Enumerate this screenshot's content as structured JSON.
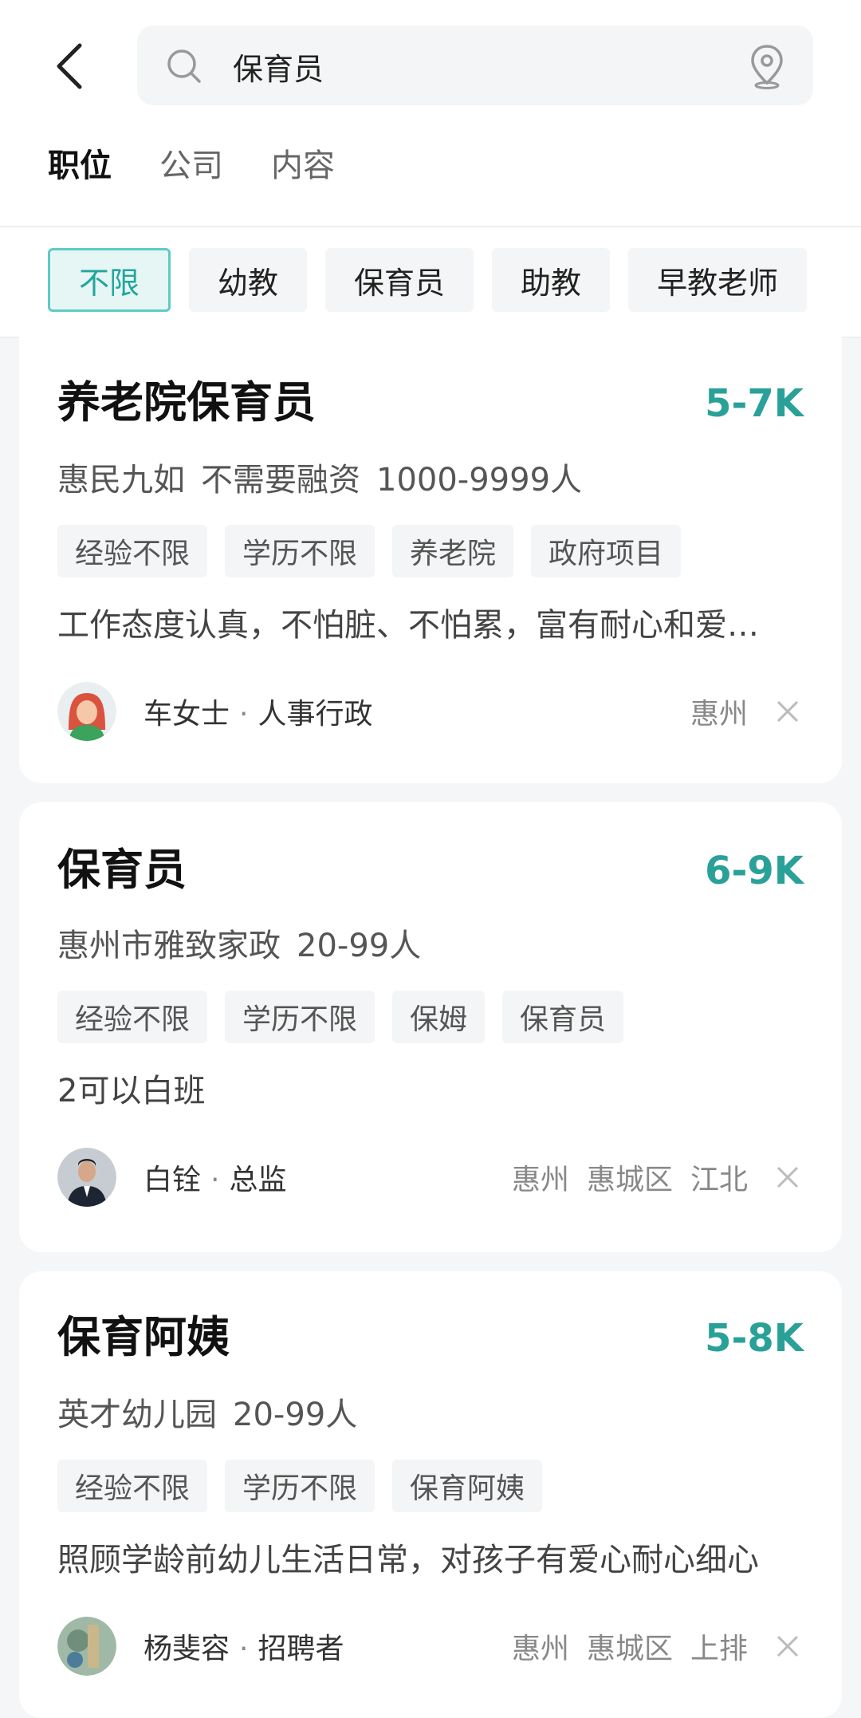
{
  "search": {
    "query": "保育员"
  },
  "tabs": [
    {
      "label": "职位",
      "active": true
    },
    {
      "label": "公司",
      "active": false
    },
    {
      "label": "内容",
      "active": false
    }
  ],
  "filters": [
    {
      "label": "不限",
      "active": true
    },
    {
      "label": "幼教",
      "active": false
    },
    {
      "label": "保育员",
      "active": false
    },
    {
      "label": "助教",
      "active": false
    },
    {
      "label": "早教老师",
      "active": false
    }
  ],
  "colors": {
    "accent": "#2aa198",
    "chip_active_bg": "#e6f6f5",
    "chip_active_border": "#5ecbc4"
  },
  "jobs": [
    {
      "title": "养老院保育员",
      "salary": "5-7K",
      "company": [
        "惠民九如",
        "不需要融资",
        "1000-9999人"
      ],
      "tags": [
        "经验不限",
        "学历不限",
        "养老院",
        "政府项目"
      ],
      "desc": "工作态度认真，不怕脏、不怕累，富有耐心和爱…",
      "recruiter_name": "车女士",
      "recruiter_role": "人事行政",
      "location": [
        "惠州"
      ]
    },
    {
      "title": "保育员",
      "salary": "6-9K",
      "company": [
        "惠州市雅致家政",
        "20-99人"
      ],
      "tags": [
        "经验不限",
        "学历不限",
        "保姆",
        "保育员"
      ],
      "desc": "2可以白班",
      "recruiter_name": "白铨",
      "recruiter_role": "总监",
      "location": [
        "惠州",
        "惠城区",
        "江北"
      ]
    },
    {
      "title": "保育阿姨",
      "salary": "5-8K",
      "company": [
        "英才幼儿园",
        "20-99人"
      ],
      "tags": [
        "经验不限",
        "学历不限",
        "保育阿姨"
      ],
      "desc": "照顾学龄前幼儿生活日常，对孩子有爱心耐心细心",
      "recruiter_name": "杨斐容",
      "recruiter_role": "招聘者",
      "location": [
        "惠州",
        "惠城区",
        "上排"
      ]
    }
  ]
}
